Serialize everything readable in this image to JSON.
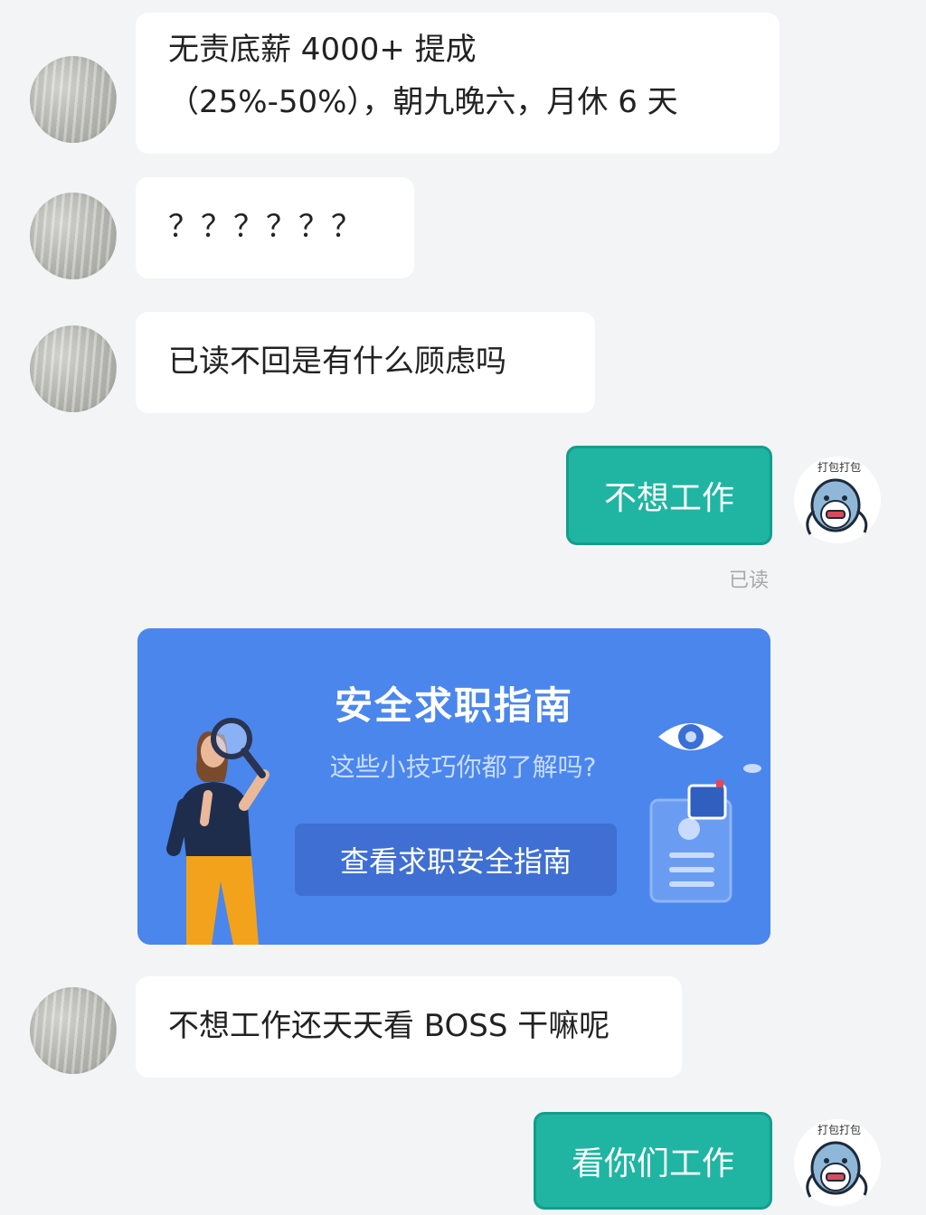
{
  "messages": {
    "m1": {
      "line1": "无责底薪 4000+ 提成",
      "line2": "（25%-50%），朝九晚六，月休 6 天"
    },
    "m2": {
      "text": "？？？？？？"
    },
    "m3": {
      "text": "已读不回是有什么顾虑吗"
    },
    "m4": {
      "text": "不想工作",
      "status": "已读"
    },
    "m5": {
      "text": "不想工作还天天看 BOSS 干嘛呢"
    },
    "m6": {
      "text": "看你们工作"
    }
  },
  "safety_card": {
    "title": "安全求职指南",
    "subtitle": "这些小技巧你都了解吗?",
    "button_label": "查看求职安全指南"
  },
  "self_avatar": {
    "caption": "打包打包"
  },
  "colors": {
    "outgoing_bubble": "#1fb5a2",
    "card_background": "#4a86ec",
    "page_background": "#f3f4f6"
  },
  "icons": [
    "shark-sticker-avatar",
    "magnifier-woman-illustration",
    "eye-icon",
    "document-illustration"
  ]
}
